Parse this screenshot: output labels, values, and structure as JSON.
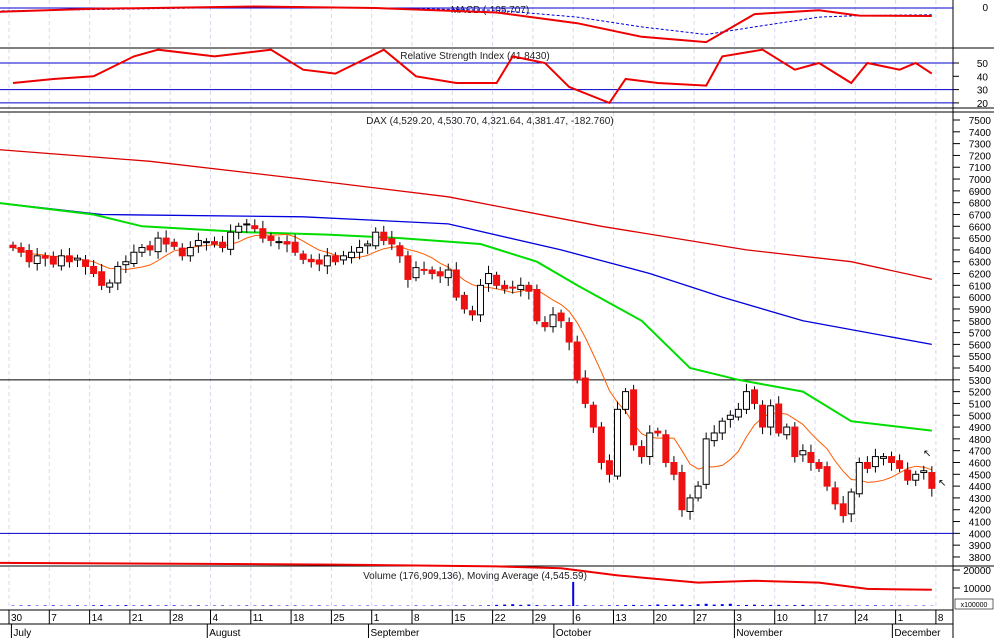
{
  "chart_data": {
    "type": "candlestick",
    "panels": {
      "macd": {
        "title": "MACD (-105.707)",
        "ticks": [
          "0"
        ]
      },
      "rsi": {
        "title": "Relative Strength Index (41.8430)",
        "ticks": [
          "50",
          "40",
          "30",
          "20"
        ],
        "levels": [
          50,
          30,
          20
        ]
      },
      "price": {
        "title": "DAX (4,529.20, 4,530.70, 4,321.64, 4,381.47, -182.760)",
        "ylim": [
          3750,
          7550
        ],
        "ticks": [
          "7500",
          "7400",
          "7300",
          "7200",
          "7100",
          "7000",
          "6900",
          "6800",
          "6700",
          "6600",
          "6500",
          "6400",
          "6300",
          "6200",
          "6100",
          "6000",
          "5900",
          "5800",
          "5700",
          "5600",
          "5500",
          "5400",
          "5300",
          "5200",
          "5100",
          "5000",
          "4900",
          "4800",
          "4700",
          "4600",
          "4500",
          "4400",
          "4300",
          "4200",
          "4100",
          "4000",
          "3900",
          "3800"
        ],
        "hlines": [
          5300,
          4000
        ]
      },
      "volume": {
        "title": "Volume (176,909,136), Moving Average (4,545.59)",
        "ticks": [
          "20000",
          "10000"
        ],
        "multiplier": "x100000"
      }
    },
    "closes": [
      6420,
      6380,
      6300,
      6350,
      6330,
      6280,
      6350,
      6300,
      6330,
      6260,
      6200,
      6100,
      6120,
      6260,
      6300,
      6380,
      6420,
      6400,
      6500,
      6450,
      6430,
      6350,
      6420,
      6480,
      6470,
      6450,
      6420,
      6550,
      6600,
      6620,
      6580,
      6500,
      6480,
      6470,
      6450,
      6380,
      6320,
      6300,
      6280,
      6350,
      6300,
      6350,
      6380,
      6420,
      6450,
      6550,
      6480,
      6450,
      6350,
      6150,
      6250,
      6230,
      6200,
      6180,
      6230,
      6000,
      5900,
      5850,
      6100,
      6200,
      6100,
      6070,
      6080,
      6100,
      6050,
      5800,
      5750,
      5850,
      5800,
      5620,
      5300,
      5100,
      4900,
      4600,
      4500,
      5050,
      5200,
      4750,
      4650,
      4850,
      4850,
      4600,
      4500,
      4200,
      4300,
      4400,
      4800,
      4850,
      4950,
      5000,
      5050,
      5200,
      5100,
      4900,
      5080,
      4850,
      4900,
      4650,
      4700,
      4600,
      4550,
      4400,
      4250,
      4150,
      4350,
      4600,
      4550,
      4650,
      4650,
      4600,
      4550,
      4450,
      4500,
      4530,
      4381
    ],
    "ma_green": [
      [
        -2,
        6800
      ],
      [
        10,
        6700
      ],
      [
        16,
        6600
      ],
      [
        29,
        6550
      ],
      [
        39,
        6530
      ],
      [
        48,
        6500
      ],
      [
        58,
        6450
      ],
      [
        65,
        6300
      ],
      [
        70,
        6100
      ],
      [
        78,
        5800
      ],
      [
        84,
        5400
      ],
      [
        90,
        5300
      ],
      [
        98,
        5200
      ],
      [
        104,
        4950
      ],
      [
        114,
        4870
      ]
    ],
    "ma_blue": [
      [
        -2,
        6800
      ],
      [
        11,
        6700
      ],
      [
        36,
        6680
      ],
      [
        54,
        6620
      ],
      [
        68,
        6400
      ],
      [
        79,
        6200
      ],
      [
        88,
        6000
      ],
      [
        98,
        5800
      ],
      [
        114,
        5600
      ]
    ],
    "ma_red": [
      [
        -2,
        7250
      ],
      [
        17,
        7150
      ],
      [
        36,
        7000
      ],
      [
        54,
        6850
      ],
      [
        73,
        6600
      ],
      [
        91,
        6400
      ],
      [
        104,
        6300
      ],
      [
        114,
        6150
      ]
    ],
    "macd_line": [
      [
        -2,
        -50
      ],
      [
        10,
        -10
      ],
      [
        30,
        20
      ],
      [
        45,
        0
      ],
      [
        60,
        -60
      ],
      [
        70,
        -200
      ],
      [
        78,
        -380
      ],
      [
        86,
        -450
      ],
      [
        92,
        -80
      ],
      [
        100,
        -30
      ],
      [
        105,
        -100
      ],
      [
        114,
        -106
      ]
    ],
    "macd_signal": [
      [
        -2,
        -40
      ],
      [
        10,
        -20
      ],
      [
        30,
        10
      ],
      [
        45,
        0
      ],
      [
        60,
        -30
      ],
      [
        70,
        -120
      ],
      [
        78,
        -250
      ],
      [
        86,
        -350
      ],
      [
        92,
        -250
      ],
      [
        100,
        -120
      ],
      [
        105,
        -100
      ],
      [
        114,
        -90
      ]
    ],
    "rsi_line": [
      [
        0,
        35
      ],
      [
        5,
        38
      ],
      [
        10,
        40
      ],
      [
        15,
        55
      ],
      [
        18,
        60
      ],
      [
        25,
        55
      ],
      [
        32,
        60
      ],
      [
        36,
        45
      ],
      [
        40,
        42
      ],
      [
        46,
        60
      ],
      [
        50,
        40
      ],
      [
        55,
        35
      ],
      [
        60,
        35
      ],
      [
        62,
        55
      ],
      [
        66,
        50
      ],
      [
        69,
        32
      ],
      [
        74,
        20
      ],
      [
        76,
        38
      ],
      [
        80,
        35
      ],
      [
        86,
        33
      ],
      [
        88,
        55
      ],
      [
        93,
        60
      ],
      [
        97,
        45
      ],
      [
        100,
        50
      ],
      [
        104,
        35
      ],
      [
        106,
        50
      ],
      [
        110,
        45
      ],
      [
        112,
        50
      ],
      [
        114,
        42
      ]
    ],
    "volume_weekly": [
      300,
      300,
      400,
      350,
      300,
      250,
      300,
      250,
      200,
      200,
      250,
      300,
      800,
      400,
      300,
      500,
      700,
      1000,
      600,
      500,
      300,
      300,
      200
    ],
    "volume_ma": [
      [
        -2,
        24000
      ],
      [
        40,
        23000
      ],
      [
        60,
        22000
      ],
      [
        68,
        21000
      ],
      [
        75,
        17000
      ],
      [
        85,
        13000
      ],
      [
        92,
        14000
      ],
      [
        100,
        13000
      ],
      [
        106,
        9500
      ],
      [
        114,
        9000
      ]
    ],
    "volume_spike_day": 70,
    "x_axis": {
      "days": [
        {
          "label": "30",
          "d": 0
        },
        {
          "label": "7",
          "d": 5
        },
        {
          "label": "14",
          "d": 10
        },
        {
          "label": "21",
          "d": 15
        },
        {
          "label": "28",
          "d": 20
        },
        {
          "label": "4",
          "d": 25
        },
        {
          "label": "11",
          "d": 30
        },
        {
          "label": "18",
          "d": 35
        },
        {
          "label": "25",
          "d": 40
        },
        {
          "label": "1",
          "d": 45
        },
        {
          "label": "8",
          "d": 50
        },
        {
          "label": "15",
          "d": 55
        },
        {
          "label": "22",
          "d": 60
        },
        {
          "label": "29",
          "d": 65
        },
        {
          "label": "6",
          "d": 70
        },
        {
          "label": "13",
          "d": 75
        },
        {
          "label": "20",
          "d": 80
        },
        {
          "label": "27",
          "d": 85
        },
        {
          "label": "3",
          "d": 90
        },
        {
          "label": "10",
          "d": 95
        },
        {
          "label": "17",
          "d": 100
        },
        {
          "label": "24",
          "d": 105
        },
        {
          "label": "1",
          "d": 110
        },
        {
          "label": "8",
          "d": 115
        }
      ],
      "months": [
        {
          "label": "July",
          "d": 0.3
        },
        {
          "label": "August",
          "d": 24.6
        },
        {
          "label": "September",
          "d": 44.6
        },
        {
          "label": "October",
          "d": 67.6
        },
        {
          "label": "November",
          "d": 90
        },
        {
          "label": "December",
          "d": 109.6
        }
      ]
    }
  }
}
